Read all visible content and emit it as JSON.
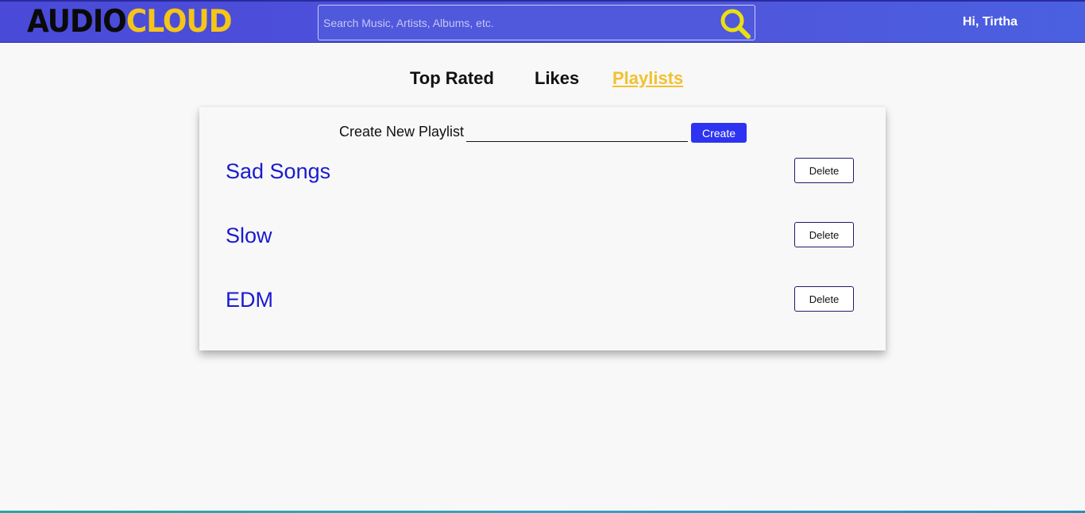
{
  "app": {
    "logo_part1": "AUDIO",
    "logo_part2": "CLOUD",
    "greeting": "Hi, Tirtha"
  },
  "search": {
    "placeholder": "Search Music, Artists, Albums, etc.",
    "value": "",
    "icon": "search-icon"
  },
  "tabs": [
    {
      "label": "Top Rated",
      "active": false
    },
    {
      "label": "Likes",
      "active": false
    },
    {
      "label": "Playlists",
      "active": true
    }
  ],
  "create": {
    "label": "Create New Playlist",
    "input_value": "",
    "button_label": "Create"
  },
  "playlists": [
    {
      "name": "Sad Songs",
      "delete_label": "Delete"
    },
    {
      "name": "Slow",
      "delete_label": "Delete"
    },
    {
      "name": "EDM",
      "delete_label": "Delete"
    }
  ],
  "colors": {
    "header": "#4f57dc",
    "accent_yellow": "#f2c12e",
    "playlist_link": "#1a1ad0",
    "create_button": "#2d33f0"
  }
}
